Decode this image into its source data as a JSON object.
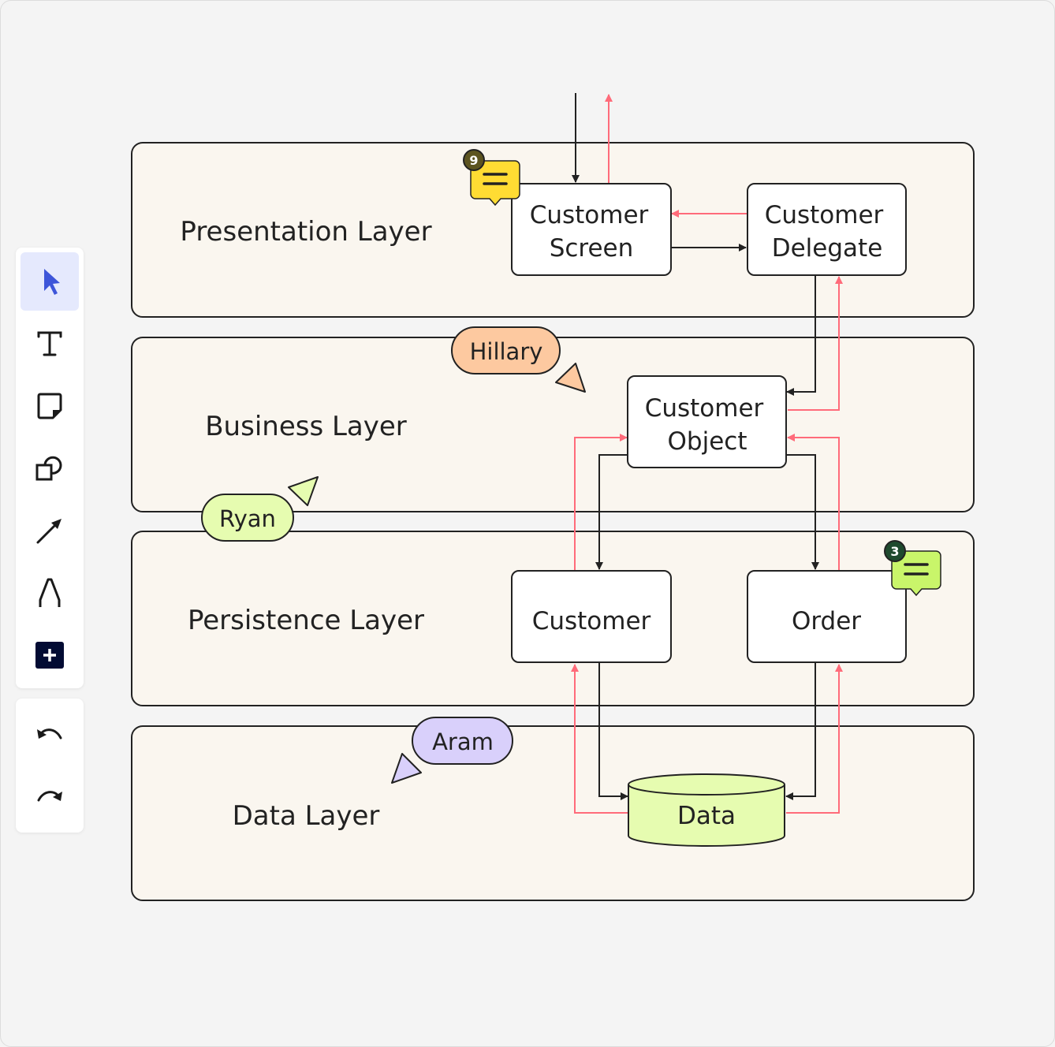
{
  "colors": {
    "lane_fill": "#faf6ef",
    "stroke": "#222222",
    "return_arrow": "#ff6b7a",
    "data_fill": "#e6fcb0",
    "accent": "#3d55d9"
  },
  "toolbar": {
    "tools": [
      {
        "name": "select",
        "icon": "cursor-icon",
        "active": true
      },
      {
        "name": "text",
        "icon": "text-icon"
      },
      {
        "name": "sticky-note",
        "icon": "sticky-note-icon"
      },
      {
        "name": "shapes",
        "icon": "shapes-icon"
      },
      {
        "name": "connector",
        "icon": "arrow-icon"
      },
      {
        "name": "pen",
        "icon": "pen-icon"
      },
      {
        "name": "more",
        "icon": "plus-icon"
      }
    ],
    "history": [
      {
        "name": "undo",
        "icon": "undo-icon"
      },
      {
        "name": "redo",
        "icon": "redo-icon"
      }
    ]
  },
  "lanes": [
    "Presentation Layer",
    "Business Layer",
    "Persistence Layer",
    "Data Layer"
  ],
  "nodes": {
    "customer_screen": [
      "Customer",
      "Screen"
    ],
    "customer_delegate": [
      "Customer",
      "Delegate"
    ],
    "customer_object": [
      "Customer",
      "Object"
    ],
    "customer": "Customer",
    "order": "Order",
    "data": "Data"
  },
  "cursors": [
    {
      "name": "Hillary",
      "color": "#fdc9a0"
    },
    {
      "name": "Ryan",
      "color": "#e6fcb0"
    },
    {
      "name": "Aram",
      "color": "#d9d0fb"
    }
  ],
  "comments": [
    {
      "count": "9",
      "color": "#ffdc33",
      "badge_color": "#5c5420"
    },
    {
      "count": "3",
      "color": "#c9f56a",
      "badge_color": "#1f4a2e"
    }
  ]
}
